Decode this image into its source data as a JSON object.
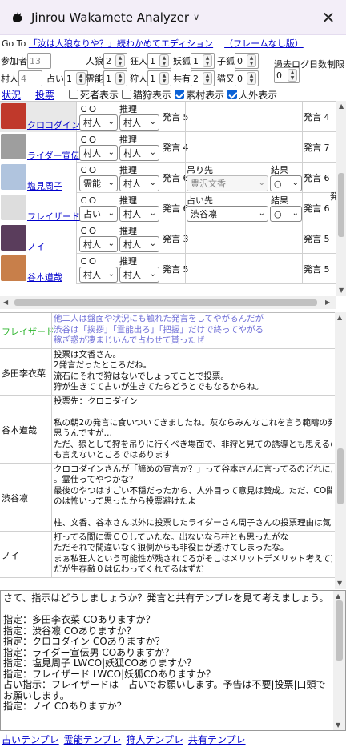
{
  "window": {
    "title": "Jinrou Wakamete Analyzer",
    "close_glyph": "✕",
    "chevron": "∨"
  },
  "goto": {
    "prefix": "Go To",
    "link1": "「汝は人狼なりや？」続わかめてエディション",
    "link2": "（フレームなし版）"
  },
  "counts": {
    "fields": [
      {
        "label": "参加者",
        "value": "13",
        "gray": true
      },
      {
        "label": "人狼",
        "value": "2"
      },
      {
        "label": "狂人",
        "value": "1"
      },
      {
        "label": "妖狐",
        "value": "1"
      },
      {
        "label": "子狐",
        "value": "0"
      },
      {
        "label": "村人",
        "value": "4",
        "gray": true
      },
      {
        "label": "占い",
        "value": "1"
      },
      {
        "label": "霊能",
        "value": "1"
      },
      {
        "label": "狩人",
        "value": "1"
      },
      {
        "label": "共有",
        "value": "2"
      },
      {
        "label": "猫又",
        "value": "0"
      }
    ],
    "past_log_label": "過去ログ日数制限",
    "past_log_value": "0"
  },
  "tabs": {
    "status": "状況",
    "vote": "投票",
    "checks": [
      {
        "label": "死者表示",
        "checked": false
      },
      {
        "label": "猫狩表示",
        "checked": false
      },
      {
        "label": "素村表示",
        "checked": true
      },
      {
        "label": "人外表示",
        "checked": true
      }
    ]
  },
  "grid": {
    "co_label": "ＣＯ",
    "guess_label": "推理",
    "speech_label": "発言",
    "rows": [
      {
        "name": "クロコダイン",
        "co": "村人",
        "guess": "村人",
        "speech": "発言 5",
        "extra_label": "",
        "extra_value": "",
        "result_label": "",
        "result_value": "",
        "right": "発言 4",
        "avatar_color": "#c0392b"
      },
      {
        "name": "ライダー宣伝男",
        "co": "村人",
        "guess": "村人",
        "speech": "発言 4",
        "extra_label": "",
        "extra_value": "",
        "result_label": "",
        "result_value": "",
        "right": "発言 7",
        "avatar_color": "#9e9e9e"
      },
      {
        "name": "塩見周子",
        "co": "霊能",
        "guess": "村人",
        "speech": "発言 6",
        "extra_label": "吊り先",
        "extra_value": "豊沢文香",
        "result_label": "結果",
        "result_value": "○",
        "right": "発言 6",
        "avatar_color": "#b0c4de"
      },
      {
        "name": "フレイザード",
        "co": "占い",
        "guess": "村人",
        "speech": "発言 6",
        "extra_label": "占い先",
        "extra_value": "渋谷凛",
        "result_label": "結果",
        "result_value": "○",
        "right": "発言 6",
        "avatar_color": "#dddddd"
      },
      {
        "name": "ノイ",
        "co": "村人",
        "guess": "村人",
        "speech": "発言 3",
        "extra_label": "",
        "extra_value": "",
        "result_label": "",
        "result_value": "",
        "right": "発言 5",
        "avatar_color": "#5a3d5c"
      },
      {
        "name": "谷本道哉",
        "co": "村人",
        "guess": "村人",
        "speech": "発言 5",
        "extra_label": "",
        "extra_value": "",
        "result_label": "",
        "result_value": "",
        "right": "発言 5",
        "avatar_color": "#c87f4a"
      }
    ],
    "far_right": "発"
  },
  "log": [
    {
      "name": "フレイザード",
      "name_color": "#2db52d",
      "text_color": "#6f6fd8",
      "lines": [
        "他二人は盤面や状況にも触れた発言をしてやがるんだが",
        "渋谷は「挨拶」「霊能出ろ」「把握」だけで終ってやがる",
        "稼ぎ惑が凄まじいんで占わせて貰ったぜ"
      ]
    },
    {
      "name": "多田李衣菜",
      "name_color": "#111",
      "text_color": "#111",
      "lines": [
        "投票は文香さん。",
        "2発言だったところだね。",
        "流石にそれで狩はないでしょってことで投票。",
        "狩が生きてて占いが生きてたらどうとでもなるからね。"
      ]
    },
    {
      "name": "谷本道哉",
      "name_color": "#111",
      "text_color": "#111",
      "lines": [
        "投票先：クロコダイン",
        "",
        "私の朝2の発言に食いついてきましたね。灰ならみんなこれを言う範疇の発言だとは",
        "思うんですが…",
        "ただ、狼として狩を吊りに行くべき場面で、非狩と見ての誘導とも思えるのでなんと",
        "も言えないところではあります"
      ]
    },
    {
      "name": "渋谷凛",
      "name_color": "#111",
      "text_color": "#111",
      "lines": [
        "クロコダインさんが「諦めの宣言か？」って谷本さんに言ってるのどれに反応したんだろ",
        "。霊仕ってやつかな？",
        "最後のやつはすごい不穏だったから、人外目って意見は賛成。ただ、CO聞かずに吊る",
        "のは怖いって思ったから投票避けたよ",
        "",
        "柱、文香、谷本さん以外に投票したライダーさん周子さんの投票理由は気になるかな"
      ]
    },
    {
      "name": "ノイ",
      "name_color": "#111",
      "text_color": "#111",
      "lines": [
        "打ってる間に霊ＣＯしていたな。出ないなら柱とも思ったがな",
        "ただそれで間違いなく狼側からも非役目が透けてしまったな。",
        "まぁ私狂人という可能性が残されてるがそこはメリットデメリット考えて貰えれば･･･なか",
        "だが生存敵０は伝わってくれてるはずだ"
      ]
    }
  ],
  "textarea": {
    "lines": [
      "さて、指示はどうしましょうか？発言と共有テンプレを見て考えましょう。",
      "",
      "指定：多田李衣菜 COありますか？",
      "指定：渋谷凛 COありますか？",
      "指定：クロコダイン COありますか？",
      "指定：ライダー宣伝男 COありますか？",
      "指定：塩見周子 LWCO|妖狐COありますか？",
      "指定：フレイザード LWCO|妖狐COありますか？",
      "占い指示：フレイザードは　占いでお願いします。予告は不要|投票|口頭でお願いします。",
      "指定：ノイ COありますか？"
    ]
  },
  "templates": [
    "占いテンプレ",
    "霊能テンプレ",
    "狩人テンプレ",
    "共有テンプレ"
  ]
}
